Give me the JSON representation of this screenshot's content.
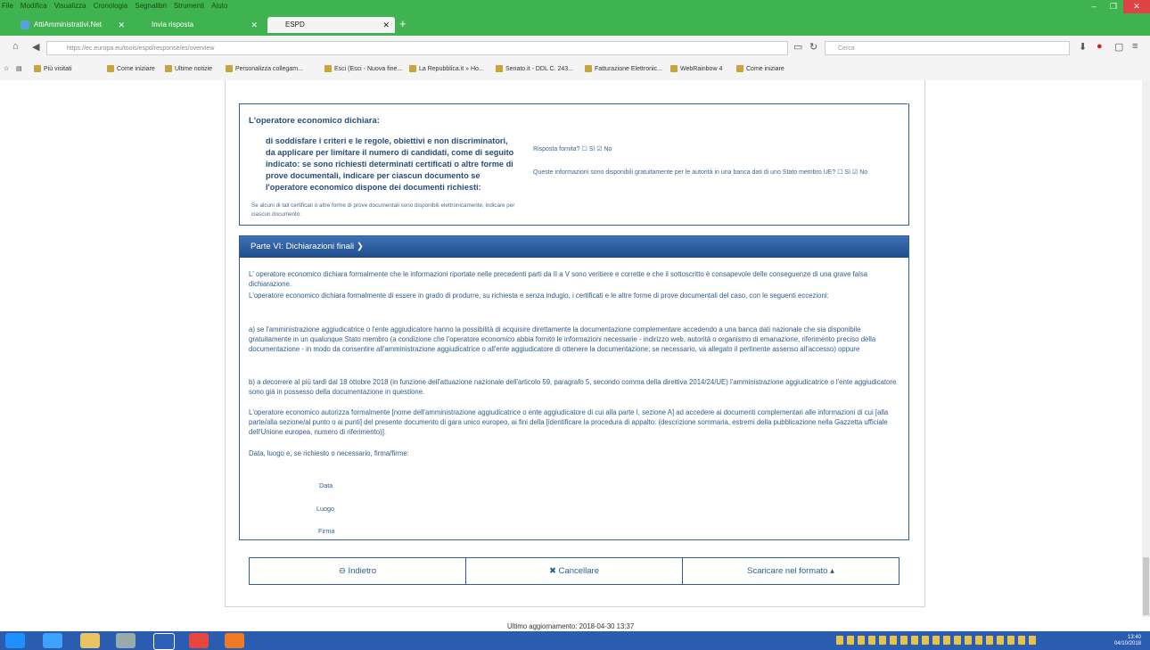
{
  "browser": {
    "menu": [
      "File",
      "Modifica",
      "Visualizza",
      "Cronologia",
      "Segnalibri",
      "Strumenti",
      "Aiuto"
    ],
    "tabs": [
      {
        "label": "AttiAmministrativi.Net"
      },
      {
        "label": "Invia risposta"
      },
      {
        "label": "ESPD"
      }
    ],
    "new_tab": "+",
    "url": "https://ec.europa.eu/tools/espd/response/es/overview",
    "search_placeholder": "Cerca",
    "bookmarks": [
      "Più visitati",
      "Come iniziare",
      "Ultime notizie",
      "Personalizza collegam...",
      "Esci (Esci - Nuova fine...",
      "La Repubblica.it » Ho...",
      "Senato.it - DDL C. 243...",
      "Fatturazione Elettronic...",
      "WebRainbow 4",
      "Come iniziare"
    ]
  },
  "section5": {
    "heading": "L'operatore economico dichiara:",
    "bold_text": "di soddisfare i criteri e le regole, obiettivi e non discriminatori, da applicare per limitare il numero di candidati, come di seguito indicato: se sono richiesti determinati certificati o altre forme di prove documentali, indicare per ciascun documento se l'operatore economico dispone dei documenti richiesti:",
    "small_text": "Se alcuni di tali certificati o altre forme di prove documentali sono disponibili elettronicamente, indicare per ciascun documento:",
    "answer": "Risposta fornita? ☐ Sì ☑ No",
    "info": "Queste informazioni sono disponibili gratuitamente per le autorità in una banca dati di uno Stato membro UE? ☐ Sì ☑ No"
  },
  "section6": {
    "header": "Parte VI: Dichiarazioni finali",
    "p1": "L' operatore economico dichiara formalmente che le informazioni riportate nelle precedenti parti da II a V sono veritiere e corrette e che il sottoscritto è consapevole delle conseguenze di una grave falsa dichiarazione.",
    "p2": "L'operatore economico dichiara formalmente di essere in grado di produrre, su richiesta e senza indugio, i certificati e le altre forme di prove documentali del caso, con le seguenti eccezioni:",
    "p3": "a) se l'amministrazione aggiudicatrice o l'ente aggiudicatore hanno la possibilità di acquisire direttamente la documentazione complementare accedendo a una banca dati nazionale che sia disponibile gratuitamente in un qualunque Stato membro (a condizione che l'operatore economico abbia fornito le informazioni necessarie - indirizzo web, autorità o organismo di emanazione, riferimento preciso della documentazione - in modo da consentire all'amministrazione aggiudicatrice o all'ente aggiudicatore di ottenere la documentazione; se necessario, va allegato il pertinente assenso all'accesso) oppure",
    "p4": "b) a decorrere al più tardi dal 18 ottobre 2018 (in funzione dell'attuazione nazionale dell'articolo 59, paragrafo 5, secondo comma della direttiva 2014/24/UE) l'amministrazione aggiudicatrice o l'ente aggiudicatore sono già in possesso della documentazione in questione.",
    "p5": "L'operatore economico autorizza formalmente [nome dell'amministrazione aggiudicatrice o ente aggiudicatore di cui alla parte I, sezione A] ad accedere ai documenti complementari alle informazioni di cui [alla parte/alla sezione/al punto o ai punti] del presente documento di gara unico europeo, ai fini della [identificare la procedura di appalto: (descrizione sommaria, estremi della pubblicazione nella Gazzetta ufficiale dell'Unione europea, numero di riferimento)].",
    "p6": "Data, luogo e, se richiesto o necessario, firma/firme:",
    "data": "Data",
    "luogo": "Luogo",
    "firma": "Firma"
  },
  "buttons": {
    "back": "⊖ Indietro",
    "cancel": "✖ Cancellare",
    "download": "Scaricare nel formato ▴"
  },
  "footer": "Ultimo aggiornamento: 2018-04-30 13:37",
  "taskbar": {
    "time": "13:40",
    "date": "04/10/2018"
  }
}
